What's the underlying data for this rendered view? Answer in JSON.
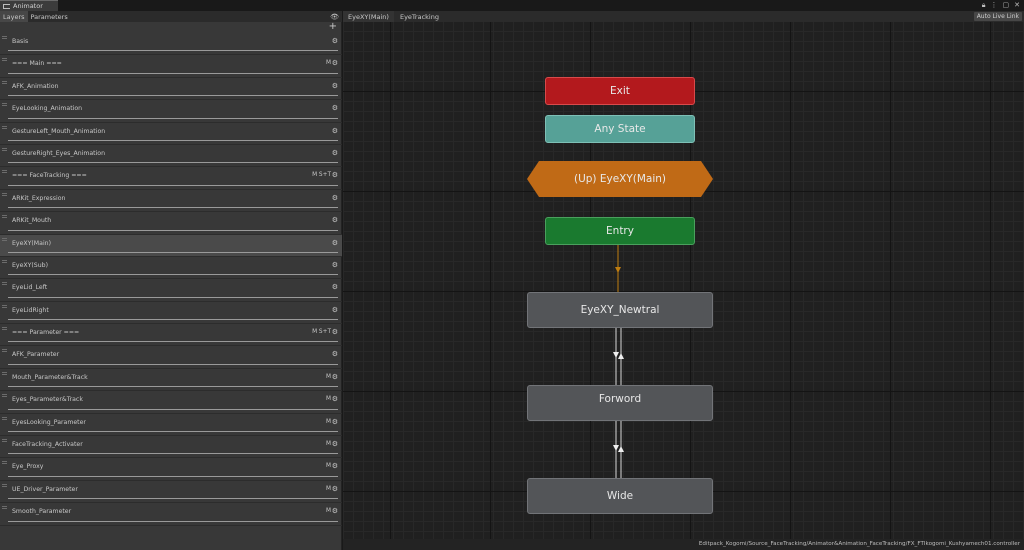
{
  "window": {
    "tab_title": "Animator"
  },
  "panel": {
    "tabs": [
      "Layers",
      "Parameters"
    ],
    "add_label": "+"
  },
  "layers": [
    {
      "name": "Basis",
      "tags": ""
    },
    {
      "name": "=== Main ===",
      "tags": "M"
    },
    {
      "name": "AFK_Animation",
      "tags": ""
    },
    {
      "name": "EyeLooking_Animation",
      "tags": ""
    },
    {
      "name": "GestureLeft_Mouth_Animation",
      "tags": ""
    },
    {
      "name": "GestureRight_Eyes_Animation",
      "tags": ""
    },
    {
      "name": "=== FaceTracking ===",
      "tags": "M S+T"
    },
    {
      "name": "ARKit_Expression",
      "tags": ""
    },
    {
      "name": "ARKit_Mouth",
      "tags": ""
    },
    {
      "name": "EyeXY(Main)",
      "tags": "",
      "selected": true
    },
    {
      "name": "EyeXY(Sub)",
      "tags": ""
    },
    {
      "name": "EyeLid_Left",
      "tags": ""
    },
    {
      "name": "EyeLidRight",
      "tags": ""
    },
    {
      "name": "=== Parameter ===",
      "tags": "M S+T"
    },
    {
      "name": "AFK_Parameter",
      "tags": ""
    },
    {
      "name": "Mouth_Parameter&Track",
      "tags": "M"
    },
    {
      "name": "Eyes_Parameter&Track",
      "tags": "M"
    },
    {
      "name": "EyesLooking_Parameter",
      "tags": "M"
    },
    {
      "name": "FaceTracking_Activater",
      "tags": "M"
    },
    {
      "name": "Eye_Proxy",
      "tags": "M"
    },
    {
      "name": "UE_Driver_Parameter",
      "tags": "M"
    },
    {
      "name": "Smooth_Parameter",
      "tags": "M"
    }
  ],
  "graph": {
    "breadcrumb": [
      "EyeXY(Main)",
      "EyeTracking"
    ],
    "auto_live_link": "Auto Live Link",
    "nodes": {
      "exit": "Exit",
      "any_state": "Any State",
      "up": "(Up) EyeXY(Main)",
      "entry": "Entry",
      "state_1": "EyeXY_Newtral",
      "state_2": "Forword",
      "state_3": "Wide"
    },
    "status_path": "Editpack_Kogomi/Source_FaceTracking/Animator&Animation_FaceTracking/FX_FTIkogomi_Kushyamech01.controller"
  },
  "colors": {
    "exit": "#b3191d",
    "any_state": "#56a197",
    "up": "#c06a16",
    "entry": "#1a7a2f",
    "state": "#535558"
  }
}
